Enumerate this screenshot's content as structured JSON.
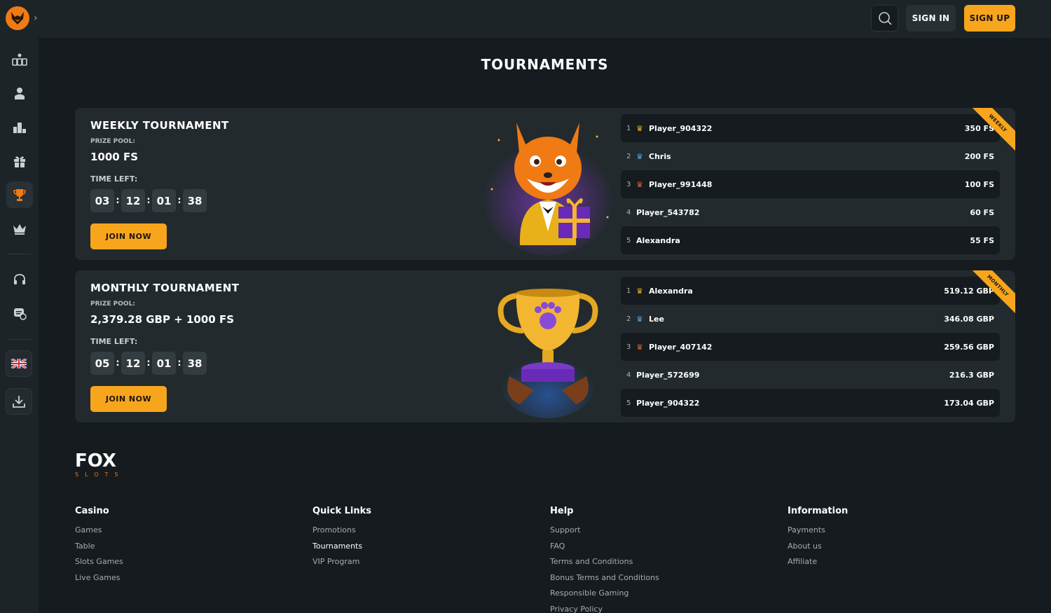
{
  "sidebar": {
    "icons": [
      "casino-games-icon",
      "live-dealer-icon",
      "leaderboard-icon",
      "gift-icon",
      "trophy-icon",
      "crown-icon",
      "headset-icon",
      "chat-support-icon",
      "uk-flag-icon",
      "download-icon"
    ]
  },
  "header": {
    "sign_in": "SIGN IN",
    "sign_up": "SIGN UP"
  },
  "page_title": "TOURNAMENTS",
  "tournaments": [
    {
      "title": "WEEKLY TOURNAMENT",
      "prize_label": "PRIZE POOL:",
      "prize_value": "1000 FS",
      "time_label": "TIME LEFT:",
      "timer": [
        "03",
        "12",
        "01",
        "38"
      ],
      "join_label": "JOIN NOW",
      "ribbon": "WEEKLY",
      "leaders": [
        {
          "rank": "1",
          "name": "Player_904322",
          "score": "350 FS"
        },
        {
          "rank": "2",
          "name": "Chris",
          "score": "200 FS"
        },
        {
          "rank": "3",
          "name": "Player_991448",
          "score": "100 FS"
        },
        {
          "rank": "4",
          "name": "Player_543782",
          "score": "60 FS"
        },
        {
          "rank": "5",
          "name": "Alexandra",
          "score": "55 FS"
        }
      ]
    },
    {
      "title": "MONTHLY TOURNAMENT",
      "prize_label": "PRIZE POOL:",
      "prize_value": "2,379.28 GBP + 1000 FS",
      "time_label": "TIME LEFT:",
      "timer": [
        "05",
        "12",
        "01",
        "38"
      ],
      "join_label": "JOIN NOW",
      "ribbon": "MONTHLY",
      "leaders": [
        {
          "rank": "1",
          "name": "Alexandra",
          "score": "519.12 GBP"
        },
        {
          "rank": "2",
          "name": "Lee",
          "score": "346.08 GBP"
        },
        {
          "rank": "3",
          "name": "Player_407142",
          "score": "259.56 GBP"
        },
        {
          "rank": "4",
          "name": "Player_572699",
          "score": "216.3 GBP"
        },
        {
          "rank": "5",
          "name": "Player_904322",
          "score": "173.04 GBP"
        }
      ]
    }
  ],
  "footer": {
    "logo_main": "FOX",
    "logo_sub": "SLOTS",
    "columns": [
      {
        "title": "Casino",
        "links": [
          "Games",
          "Table",
          "Slots Games",
          "Live Games"
        ]
      },
      {
        "title": "Quick Links",
        "links": [
          "Promotions",
          "Tournaments",
          "VIP Program"
        ]
      },
      {
        "title": "Help",
        "links": [
          "Support",
          "FAQ",
          "Terms and Conditions",
          "Bonus Terms and Conditions",
          "Responsible Gaming",
          "Privacy Policy"
        ]
      },
      {
        "title": "Information",
        "links": [
          "Payments",
          "About us",
          "Affiliate"
        ]
      }
    ]
  },
  "colors": {
    "accent": "#f7a51c",
    "brand_orange": "#f07a14",
    "gold": "#f2b630",
    "silver_blue": "#5aa6e6",
    "bronze": "#e06a3a"
  }
}
